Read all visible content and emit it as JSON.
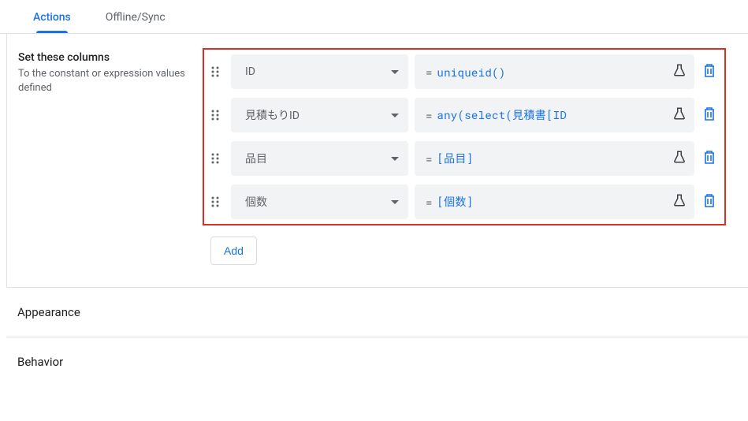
{
  "tabs": {
    "actions": "Actions",
    "offline": "Offline/Sync"
  },
  "setColumns": {
    "title": "Set these columns",
    "subtitle": "To the constant or expression values defined",
    "rows": [
      {
        "column": "ID",
        "expression": "uniqueid()"
      },
      {
        "column": "見積もりID",
        "expression": "any(select(見積書[ID"
      },
      {
        "column": "品目",
        "expression": "[品目]"
      },
      {
        "column": "個数",
        "expression": "[個数]"
      }
    ],
    "addLabel": "Add"
  },
  "sections": {
    "appearance": "Appearance",
    "behavior": "Behavior"
  }
}
